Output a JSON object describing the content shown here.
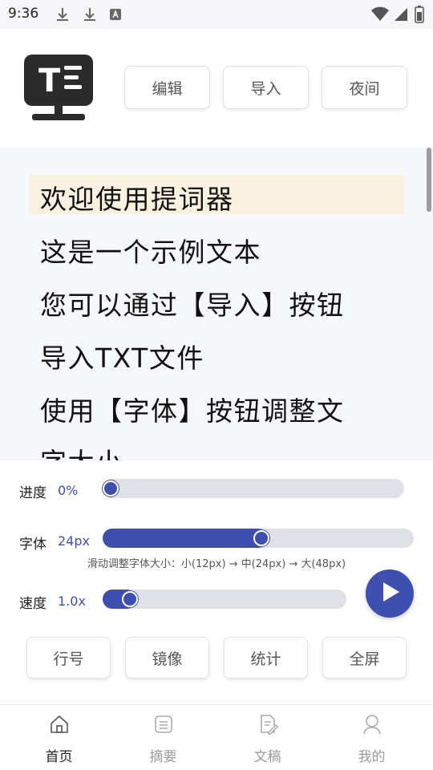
{
  "status_bar": {
    "time": "9:36"
  },
  "header": {
    "logo_text": "T",
    "buttons": {
      "edit": "编辑",
      "import": "导入",
      "night": "夜间"
    }
  },
  "script_lines": [
    "欢迎使用提词器",
    "这是一个示例文本",
    "您可以通过【导入】按钮",
    "导入TXT文件",
    "使用【字体】按钮调整文",
    "字大小"
  ],
  "controls": {
    "progress": {
      "label": "进度",
      "value": "0%",
      "fraction": 0.0
    },
    "font": {
      "label": "字体",
      "value": "24px",
      "fraction": 0.5,
      "hint": "滑动调整字体大小：小(12px) → 中(24px) → 大(48px)"
    },
    "speed": {
      "label": "速度",
      "value": "1.0x",
      "fraction": 0.1
    },
    "play_icon": "play-icon",
    "buttons": {
      "line_numbers": "行号",
      "mirror": "镜像",
      "stats": "统计",
      "fullscreen": "全屏"
    }
  },
  "nav": {
    "items": [
      {
        "label": "首页",
        "icon": "home-icon",
        "active": true
      },
      {
        "label": "摘要",
        "icon": "summary-icon",
        "active": false
      },
      {
        "label": "文稿",
        "icon": "document-edit-icon",
        "active": false
      },
      {
        "label": "我的",
        "icon": "profile-icon",
        "active": false
      }
    ]
  },
  "colors": {
    "accent": "#3f4fb0",
    "highlight": "#faf2e1",
    "nav_active": "#222222",
    "nav_inactive": "#9a9a9a"
  }
}
